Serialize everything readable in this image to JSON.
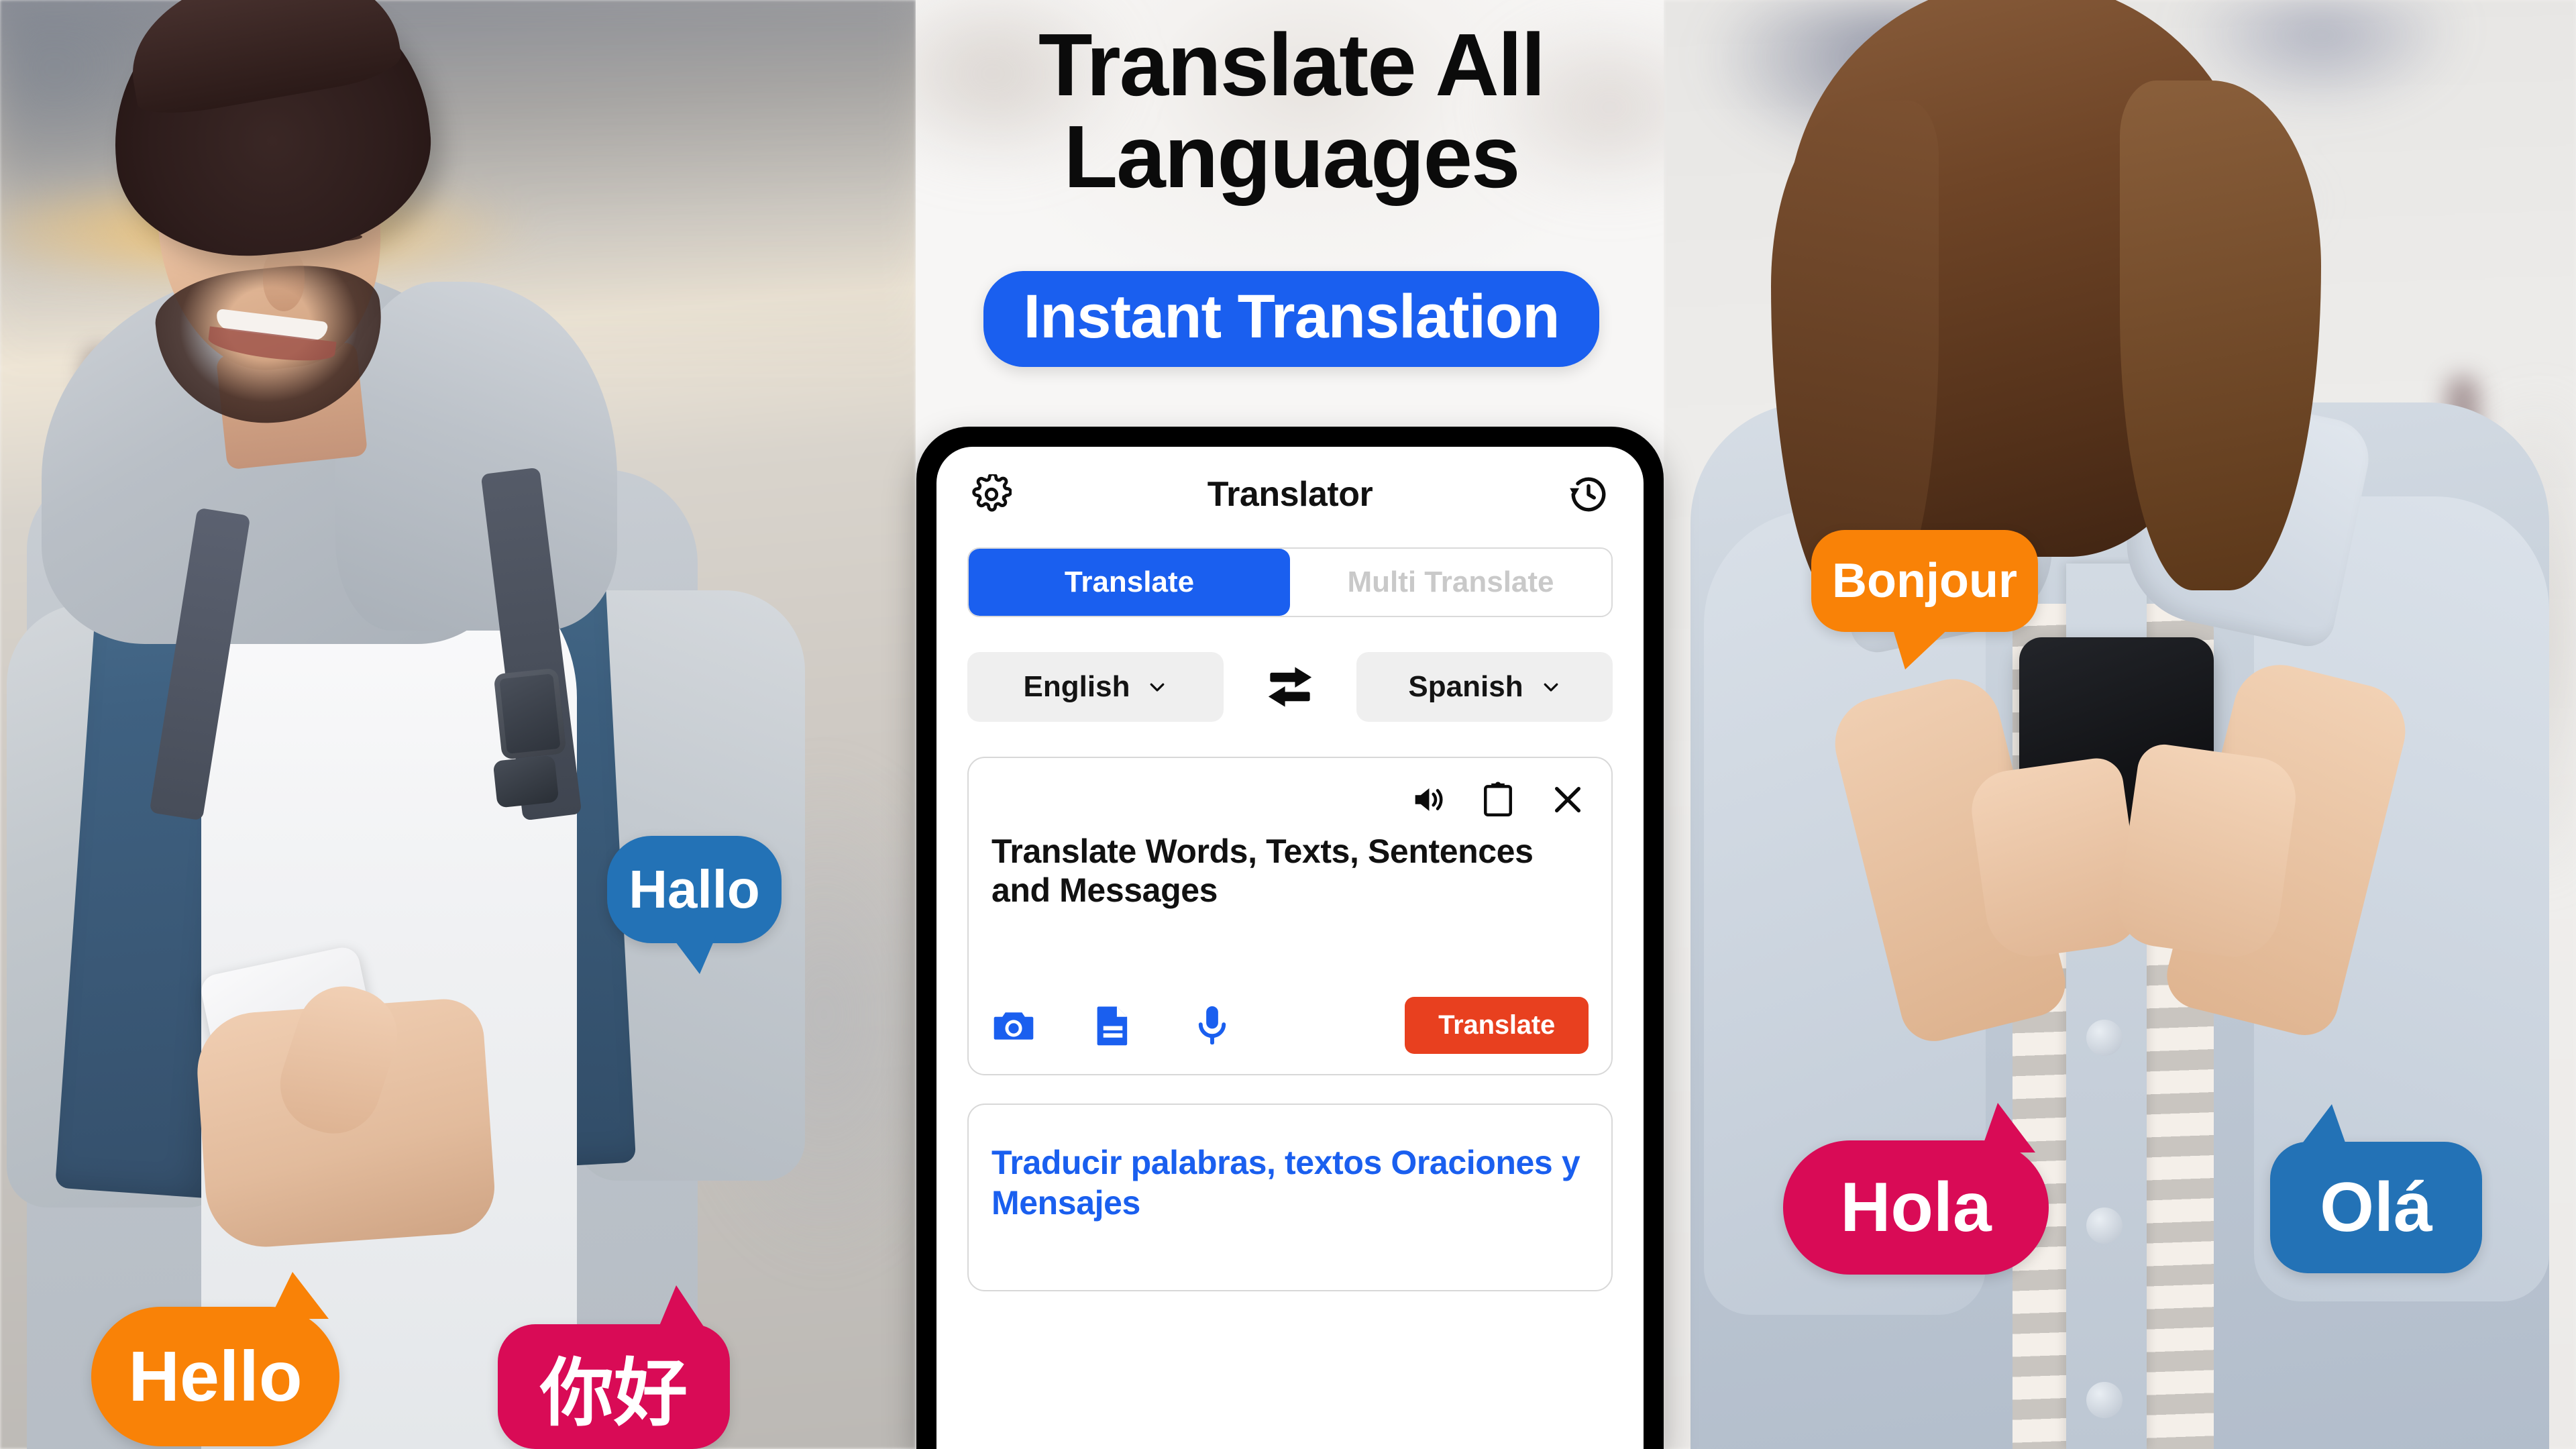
{
  "headline": {
    "line1": "Translate All",
    "line2": "Languages"
  },
  "badge": {
    "label": "Instant Translation"
  },
  "phone": {
    "app_bar": {
      "title": "Translator",
      "settings_icon": "gear-icon",
      "history_icon": "history-icon"
    },
    "tabs": [
      {
        "label": "Translate",
        "active": true
      },
      {
        "label": "Multi Translate",
        "active": false
      }
    ],
    "languages": {
      "source": "English",
      "target": "Spanish",
      "swap_icon": "swap-arrows-icon",
      "chevron_icon": "chevron-down-icon"
    },
    "source_card": {
      "tools": [
        {
          "name": "speaker-icon"
        },
        {
          "name": "clipboard-icon"
        },
        {
          "name": "close-icon"
        }
      ],
      "text": "Translate Words, Texts, Sentences and Messages",
      "actions": [
        {
          "name": "camera-icon"
        },
        {
          "name": "document-icon"
        },
        {
          "name": "microphone-icon"
        }
      ],
      "translate_button": "Translate"
    },
    "output_card": {
      "text": "Traducir palabras, textos Oraciones y Mensajes"
    }
  },
  "bubbles": [
    {
      "id": "hallo",
      "text": "Hallo",
      "color": "#2372b6"
    },
    {
      "id": "hello",
      "text": "Hello",
      "color": "#f98207"
    },
    {
      "id": "nihao",
      "text": "你好",
      "color": "#d90b56"
    },
    {
      "id": "bonjour",
      "text": "Bonjour",
      "color": "#f98207"
    },
    {
      "id": "hola",
      "text": "Hola",
      "color": "#d90b56"
    },
    {
      "id": "ola",
      "text": "Olá",
      "color": "#2372b6"
    }
  ],
  "colors": {
    "brand_blue": "#1a5fef",
    "bubble_blue": "#2372b6",
    "bubble_orange": "#f98207",
    "bubble_pink": "#d90b56",
    "translate_button": "#e8401f",
    "output_text": "#1a5fef"
  }
}
